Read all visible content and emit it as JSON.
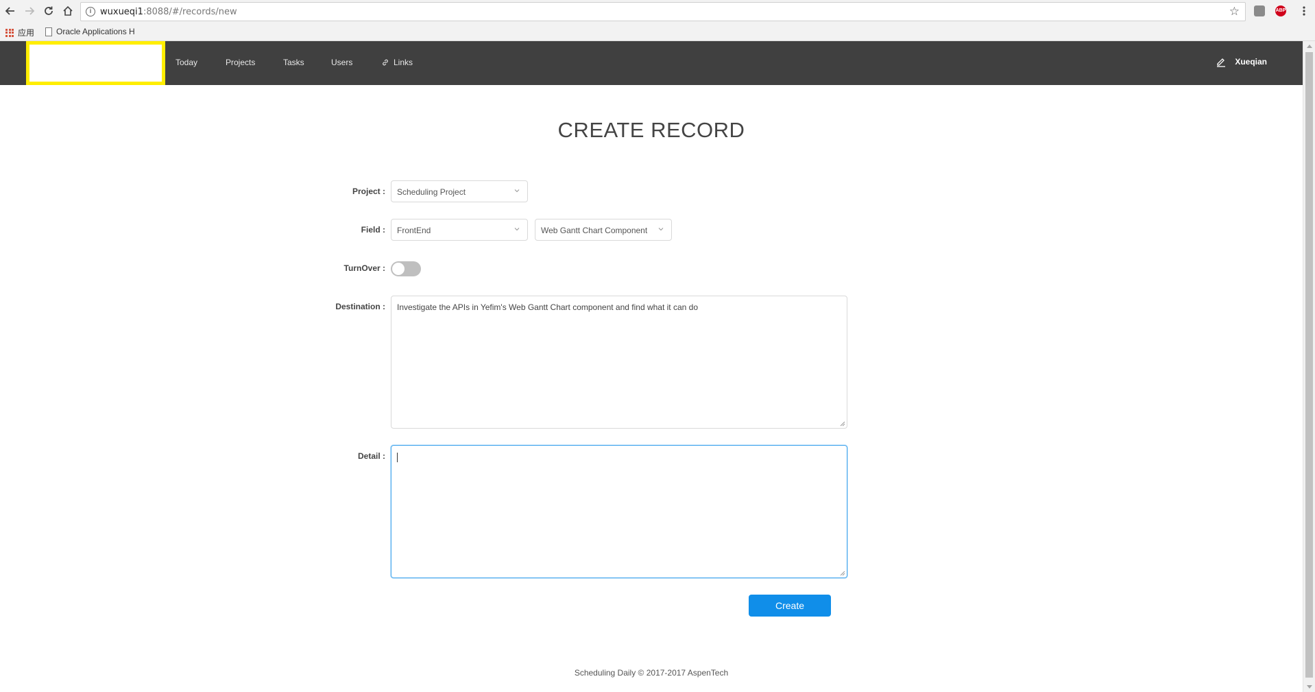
{
  "browser": {
    "url_host": "wuxueqi1",
    "url_rest": ":8088/#/records/new",
    "bookmarks": {
      "apps_label": "应用",
      "item1": "Oracle Applications H"
    },
    "ext_abp": "ABP"
  },
  "navbar": {
    "items": [
      {
        "label": "Today"
      },
      {
        "label": "Projects"
      },
      {
        "label": "Tasks"
      },
      {
        "label": "Users"
      },
      {
        "label": "Links"
      }
    ],
    "user_name": "Xueqian"
  },
  "page": {
    "title": "CREATE RECORD"
  },
  "form": {
    "project_label": "Project :",
    "project_value": "Scheduling Project",
    "field_label": "Field :",
    "field_value": "FrontEnd",
    "subfield_value": "Web Gantt Chart Component",
    "turnover_label": "TurnOver :",
    "turnover_on": false,
    "destination_label": "Destination :",
    "destination_value": "Investigate the APIs in Yefim's Web Gantt Chart component and find what it can do",
    "detail_label": "Detail :",
    "detail_value": "",
    "create_label": "Create"
  },
  "footer": {
    "text": "Scheduling Daily © 2017-2017 AspenTech"
  },
  "colors": {
    "navbar": "#404040",
    "logo_border": "#ffee00",
    "primary": "#108ee9",
    "focus": "#49a9ee"
  }
}
